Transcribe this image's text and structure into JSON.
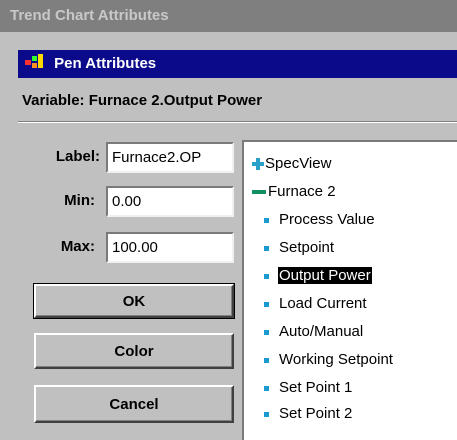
{
  "window": {
    "title": "Trend Chart Attributes"
  },
  "dialog": {
    "title": "Pen Attributes",
    "icon": "pen-color-icon"
  },
  "variable": {
    "label": "Variable:",
    "value": "Furnace 2.Output Power"
  },
  "fields": {
    "label": {
      "label": "Label:",
      "value": "Furnace2.OP"
    },
    "min": {
      "label": "Min:",
      "value": "0.00"
    },
    "max": {
      "label": "Max:",
      "value": "100.00"
    }
  },
  "buttons": {
    "ok": "OK",
    "color": "Color",
    "cancel": "Cancel"
  },
  "tree": {
    "root": {
      "label": "SpecView",
      "icon": "plus-icon"
    },
    "group": {
      "label": "Furnace 2",
      "icon": "minus-icon"
    },
    "items": [
      {
        "label": "Process Value"
      },
      {
        "label": "Setpoint"
      },
      {
        "label": "Output Power",
        "selected": true
      },
      {
        "label": "Load Current"
      },
      {
        "label": "Auto/Manual"
      },
      {
        "label": "Working Setpoint"
      },
      {
        "label": "Set Point 1"
      },
      {
        "label": "Set Point 2"
      }
    ]
  },
  "colors": {
    "titlebar_inactive": "#7f7f7f",
    "titlebar_active": "#0a0a8a",
    "face": "#c0c0c0",
    "tree_bullet": "#1a9ad0",
    "selection": "#000000"
  }
}
